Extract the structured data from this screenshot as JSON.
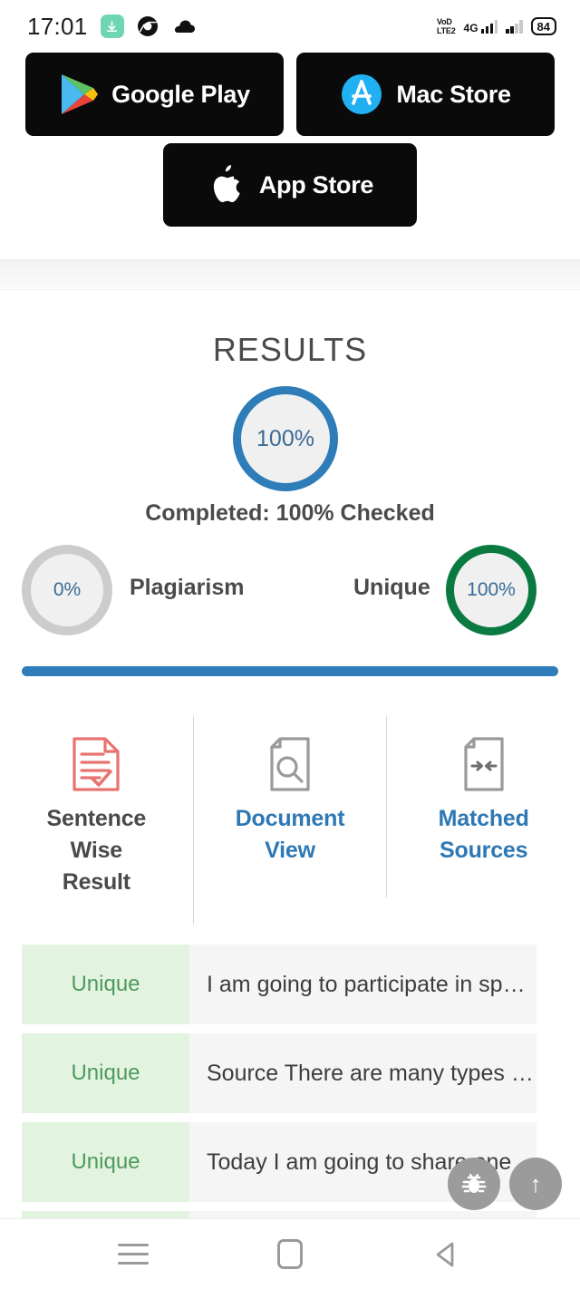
{
  "status_bar": {
    "time": "17:01",
    "icons": [
      "download-icon",
      "chrome-icon",
      "cloud-icon"
    ],
    "volte_top": "VoD",
    "volte_bottom": "LTE2",
    "network_type": "4G",
    "battery": "84"
  },
  "stores": {
    "google_play": "Google Play",
    "mac_store": "Mac Store",
    "app_store": "App Store"
  },
  "results": {
    "title": "RESULTS",
    "main_percent": "100%",
    "completed_text": "Completed: 100% Checked",
    "plagiarism_percent": "0%",
    "plagiarism_label": "Plagiarism",
    "unique_label": "Unique",
    "unique_percent": "100%",
    "progress_value": 100,
    "accent_blue": "#2e7cb8",
    "accent_green": "#0b7a41",
    "accent_gray": "#cccccc"
  },
  "tabs": [
    {
      "label_line1": "Sentence",
      "label_line2": "Wise",
      "label_line3": "Result",
      "icon": "document-check-icon",
      "active": true
    },
    {
      "label_line1": "Document",
      "label_line2": "View",
      "label_line3": "",
      "icon": "document-search-icon",
      "active": false
    },
    {
      "label_line1": "Matched",
      "label_line2": "Sources",
      "label_line3": "",
      "icon": "document-arrows-icon",
      "active": false
    }
  ],
  "sentence_rows": [
    {
      "status": "Unique",
      "text": "I am going to participate in sp…"
    },
    {
      "status": "Unique",
      "text": "Source There are many types …"
    },
    {
      "status": "Unique",
      "text": "Today I am going to share one …"
    },
    {
      "status": "",
      "text": ""
    }
  ],
  "floating_buttons": [
    {
      "name": "bug-report-button",
      "icon": "bug-icon"
    },
    {
      "name": "scroll-to-top-button",
      "icon": "arrow-up-icon",
      "glyph": "↑"
    }
  ],
  "navigation_bar": {
    "recents": "recents-icon",
    "home": "home-icon",
    "back": "back-icon"
  }
}
